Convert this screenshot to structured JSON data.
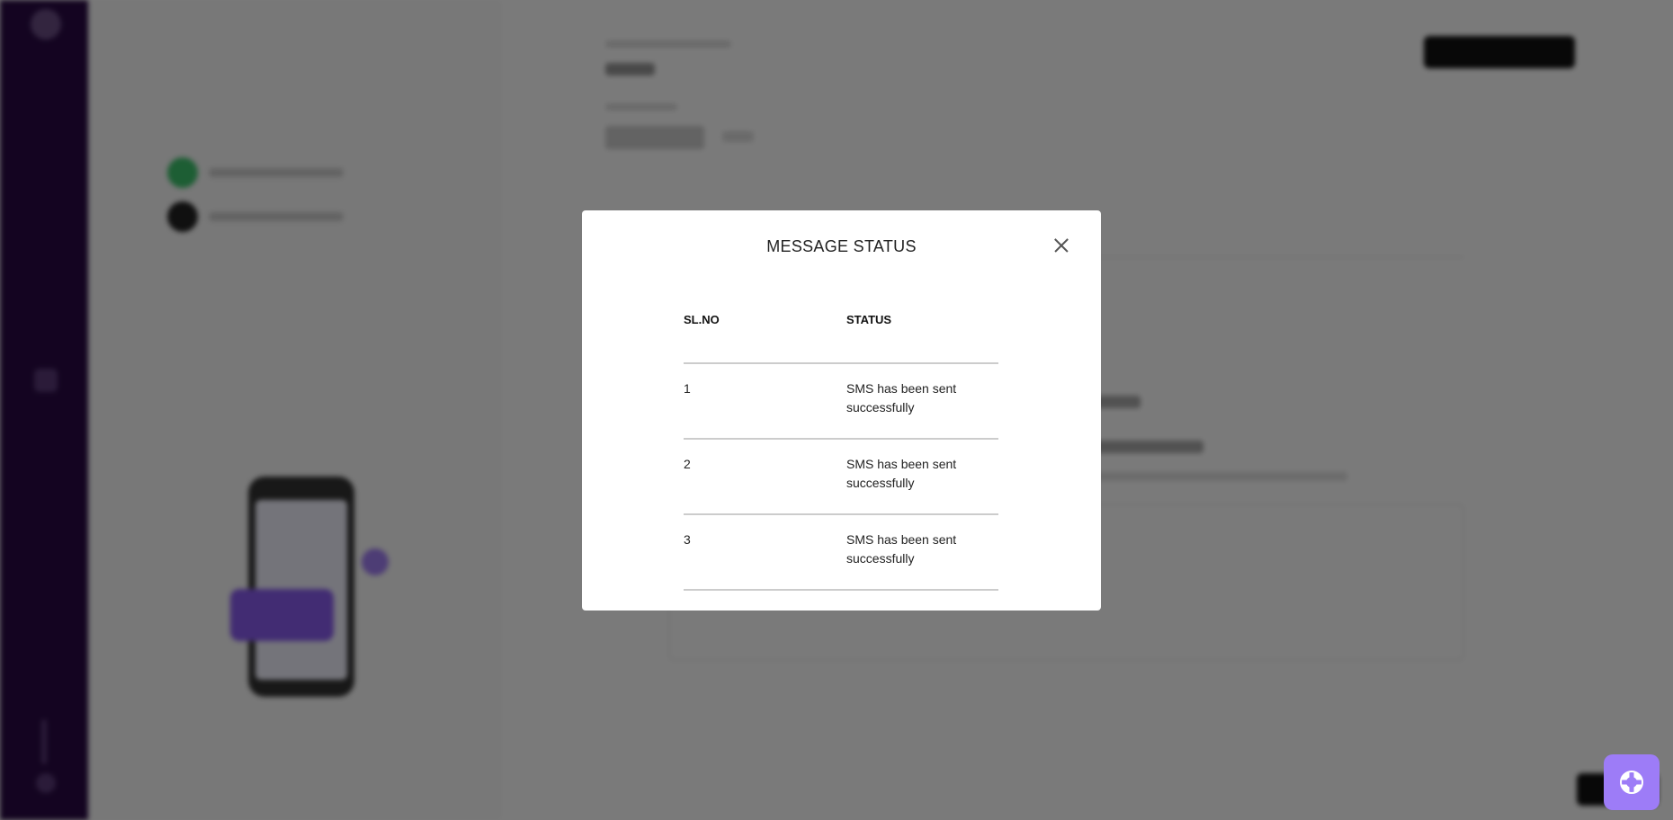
{
  "modal": {
    "title": "MESSAGE STATUS",
    "close_icon": "close-icon",
    "table": {
      "columns": [
        "SL.NO",
        "STATUS"
      ],
      "rows": [
        {
          "sl_no": "1",
          "status": "SMS has been sent successfully"
        },
        {
          "sl_no": "2",
          "status": "SMS has been sent successfully"
        },
        {
          "sl_no": "3",
          "status": "SMS has been sent successfully"
        }
      ]
    }
  },
  "help_button": {
    "icon": "lifebuoy-icon",
    "color": "#9d7cf7"
  },
  "colors": {
    "sidebar": "#2a0a45",
    "step_done": "#3ec46d",
    "accent": "#8a5cf0"
  }
}
